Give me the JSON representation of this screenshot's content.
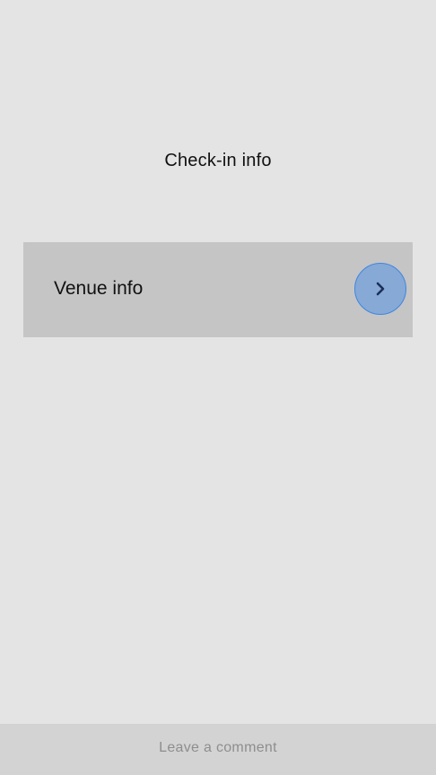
{
  "header": {
    "title": "Check-in info"
  },
  "menu": {
    "items": [
      {
        "label": "Venue info",
        "icon": "chevron-right-icon"
      }
    ]
  },
  "footer": {
    "comment_label": "Leave a comment"
  },
  "colors": {
    "background": "#e4e4e4",
    "row_background": "#c5c5c5",
    "accent_button_fill": "#86a9d6",
    "accent_button_border": "#3f86e0",
    "chevron": "#1d2f57",
    "footer_background": "#d3d3d3",
    "footer_text": "#8e8e8e"
  }
}
